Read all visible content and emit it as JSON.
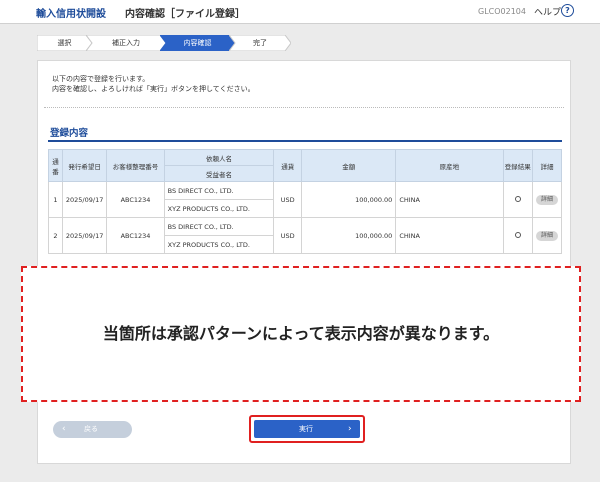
{
  "header": {
    "service_name": "輸入信用状開設",
    "page_title": "内容確認［ファイル登録］",
    "screen_id": "GLCO02104",
    "help_label": "ヘルプ",
    "help_icon": "?"
  },
  "stepper": {
    "steps": [
      {
        "label": "選択",
        "active": false
      },
      {
        "label": "補正入力",
        "active": false
      },
      {
        "label": "内容確認",
        "active": true
      },
      {
        "label": "完了",
        "active": false
      }
    ]
  },
  "message": {
    "line1": "以下の内容で登録を行います。",
    "line2": "内容を確認し、よろしければ「実行」ボタンを押してください。"
  },
  "section": {
    "title": "登録内容"
  },
  "table": {
    "headers": {
      "no": "通番",
      "issue_date": "発行希望日",
      "ref_no": "お客様整理番号",
      "applicant": "依頼人名",
      "beneficiary": "受益者名",
      "currency": "通貨",
      "amount": "金額",
      "origin": "原産地",
      "reg_result": "登録結果",
      "detail": "詳細"
    },
    "rows": [
      {
        "no": "1",
        "issue_date": "2025/09/17",
        "ref_no": "ABC1234",
        "applicant": "BS DIRECT CO., LTD.",
        "beneficiary": "XYZ PRODUCTS CO., LTD.",
        "currency": "USD",
        "amount": "100,000.00",
        "origin": "CHINA",
        "result": "○",
        "detail_label": "詳細"
      },
      {
        "no": "2",
        "issue_date": "2025/09/17",
        "ref_no": "ABC1234",
        "applicant": "BS DIRECT CO., LTD.",
        "beneficiary": "XYZ PRODUCTS CO., LTD.",
        "currency": "USD",
        "amount": "100,000.00",
        "origin": "CHINA",
        "result": "○",
        "detail_label": "詳細"
      }
    ]
  },
  "overlay": {
    "text": "当箇所は承認パターンによって表示内容が異なります。"
  },
  "buttons": {
    "back_label": "戻る",
    "execute_label": "実行"
  },
  "colors": {
    "accent": "#1e4c9a",
    "execute": "#2b62c7",
    "annotation": "#e02020",
    "active_step": "#2b62c7"
  }
}
